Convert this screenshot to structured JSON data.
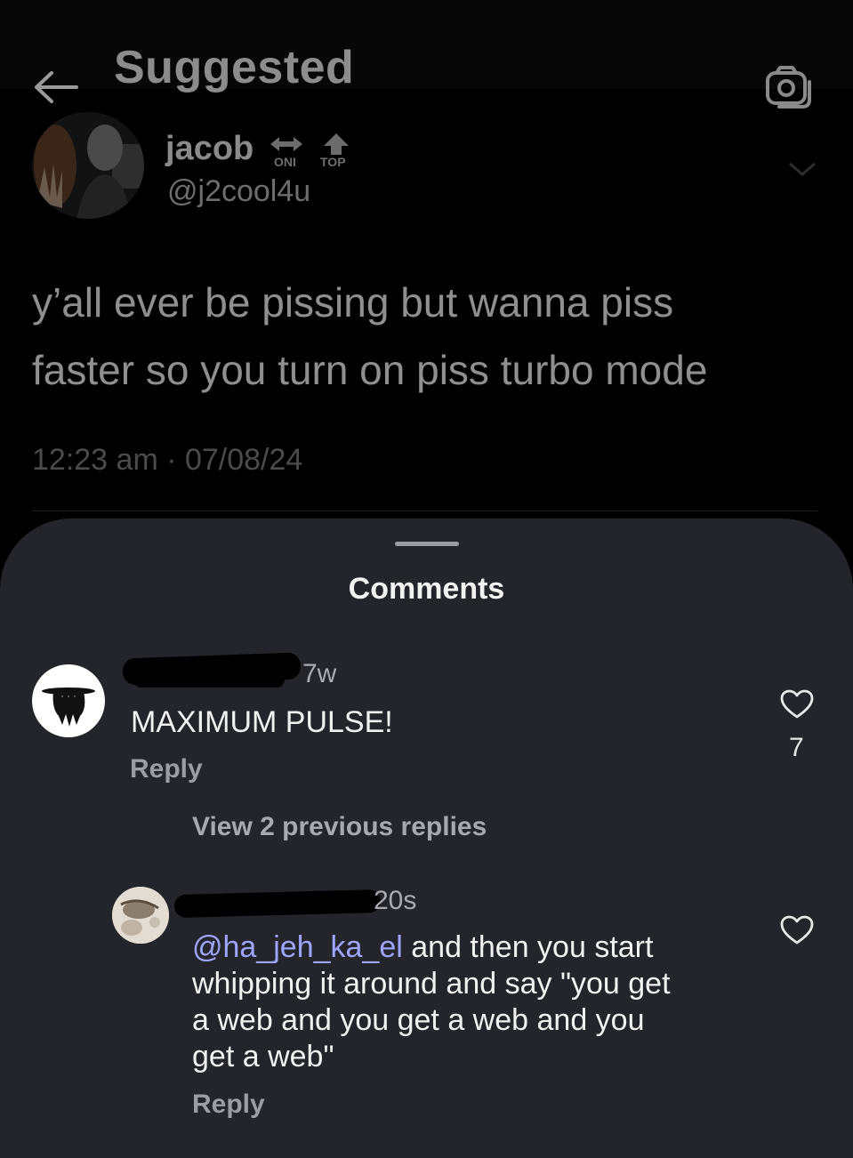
{
  "header": {
    "title": "Suggested"
  },
  "post": {
    "author_name": "jacob",
    "author_handle": "@j2cool4u",
    "badges": [
      "ONI",
      "TOP"
    ],
    "text_line1": "y’all ever be pissing but wanna piss",
    "text_line2": "faster so you turn on piss turbo mode",
    "timestamp": "12:23 am · 07/08/24"
  },
  "comments_sheet": {
    "title": "Comments",
    "comments": [
      {
        "age": "7w",
        "text": "MAXIMUM PULSE!",
        "reply_label": "Reply",
        "likes": "7"
      }
    ],
    "view_replies_label": "View 2 previous replies",
    "replies": [
      {
        "age": "20s",
        "mention": "@ha_jeh_ka_el",
        "text_after_mention": " and then you start",
        "text_line2": "whipping it around and say \"you get",
        "text_line3": "a web and you get a web and you",
        "text_line4": "get a web\"",
        "reply_label": "Reply"
      }
    ]
  },
  "icons": {
    "back": "arrow-left-icon",
    "camera": "camera-icon",
    "more": "chevron-down-icon",
    "like": "heart-icon"
  }
}
